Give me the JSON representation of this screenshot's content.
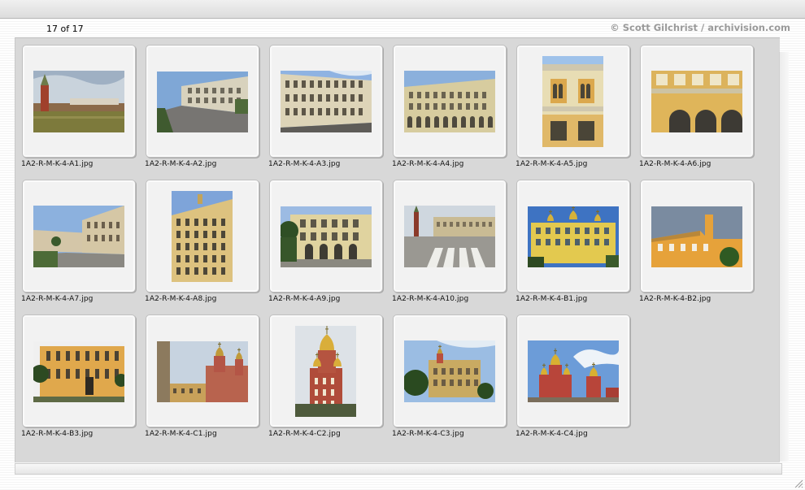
{
  "header": {
    "count": "17 of 17",
    "credit": "© Scott Gilchrist / archivision.com"
  },
  "thumbnails": [
    {
      "filename": "1A2-R-M-K-4-A1.jpg",
      "scene": "tower-river"
    },
    {
      "filename": "1A2-R-M-K-4-A2.jpg",
      "scene": "palace-street"
    },
    {
      "filename": "1A2-R-M-K-4-A3.jpg",
      "scene": "palace-wide"
    },
    {
      "filename": "1A2-R-M-K-4-A4.jpg",
      "scene": "palace-facade"
    },
    {
      "filename": "1A2-R-M-K-4-A5.jpg",
      "scene": "yellow-detail-tall"
    },
    {
      "filename": "1A2-R-M-K-4-A6.jpg",
      "scene": "yellow-arches"
    },
    {
      "filename": "1A2-R-M-K-4-A7.jpg",
      "scene": "palace-corner"
    },
    {
      "filename": "1A2-R-M-K-4-A8.jpg",
      "scene": "yellow-tall"
    },
    {
      "filename": "1A2-R-M-K-4-A9.jpg",
      "scene": "yellow-building-trees"
    },
    {
      "filename": "1A2-R-M-K-4-A10.jpg",
      "scene": "square-crossing"
    },
    {
      "filename": "1A2-R-M-K-4-B1.jpg",
      "scene": "yellow-church-blue"
    },
    {
      "filename": "1A2-R-M-K-4-B2.jpg",
      "scene": "orange-house"
    },
    {
      "filename": "1A2-R-M-K-4-B3.jpg",
      "scene": "orange-palace"
    },
    {
      "filename": "1A2-R-M-K-4-C1.jpg",
      "scene": "red-church-wall"
    },
    {
      "filename": "1A2-R-M-K-4-C2.jpg",
      "scene": "red-church-tall"
    },
    {
      "filename": "1A2-R-M-K-4-C3.jpg",
      "scene": "red-palace-trees"
    },
    {
      "filename": "1A2-R-M-K-4-C4.jpg",
      "scene": "gold-domes"
    }
  ],
  "colors": {
    "panel": "#d8d8d8",
    "slide": "#f2f2f2",
    "credit": "#9a9a9a"
  }
}
